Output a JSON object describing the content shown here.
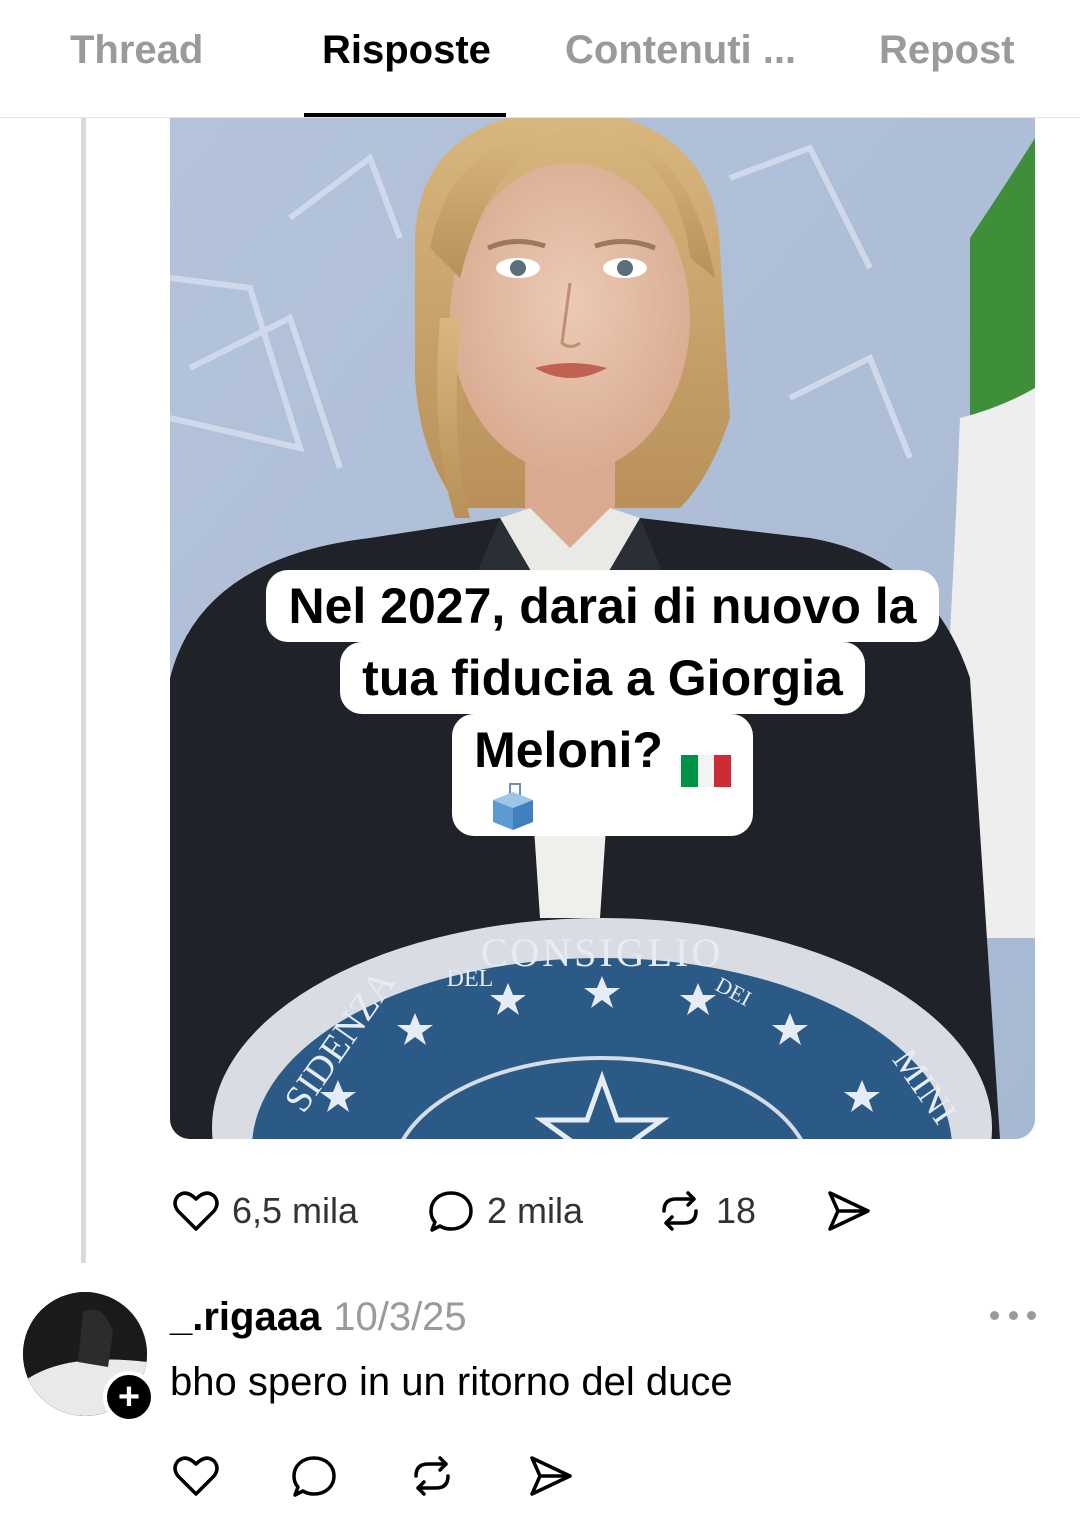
{
  "tabs": [
    {
      "label": "Thread",
      "active": false
    },
    {
      "label": "Risposte",
      "active": true
    },
    {
      "label": "Contenuti ...",
      "active": false
    },
    {
      "label": "Repost",
      "active": false
    }
  ],
  "post": {
    "image_caption": {
      "line1": "Nel 2027, darai di nuovo la",
      "line2": "tua fiducia a Giorgia",
      "line3": "Meloni?"
    },
    "image_emblem_text": {
      "top": "CONSIGLIO",
      "left": "SIDENZA",
      "del": "DEL",
      "dei": "DEI",
      "right": "MINI"
    },
    "stats": {
      "likes": "6,5 mila",
      "replies": "2 mila",
      "reposts": "18"
    },
    "icons": [
      "heart-icon",
      "comment-icon",
      "repost-icon",
      "share-icon"
    ]
  },
  "reply": {
    "username": "_.rigaaa",
    "date": "10/3/25",
    "text": "bho spero in un ritorno del duce",
    "icons": [
      "heart-icon",
      "comment-icon",
      "repost-icon",
      "share-icon"
    ]
  },
  "colors": {
    "text": "#000000",
    "muted": "#9a9a9a",
    "divider": "#e3e3e3",
    "flag_green": "#009246",
    "flag_white": "#ffffff",
    "flag_red": "#ce2b37"
  }
}
